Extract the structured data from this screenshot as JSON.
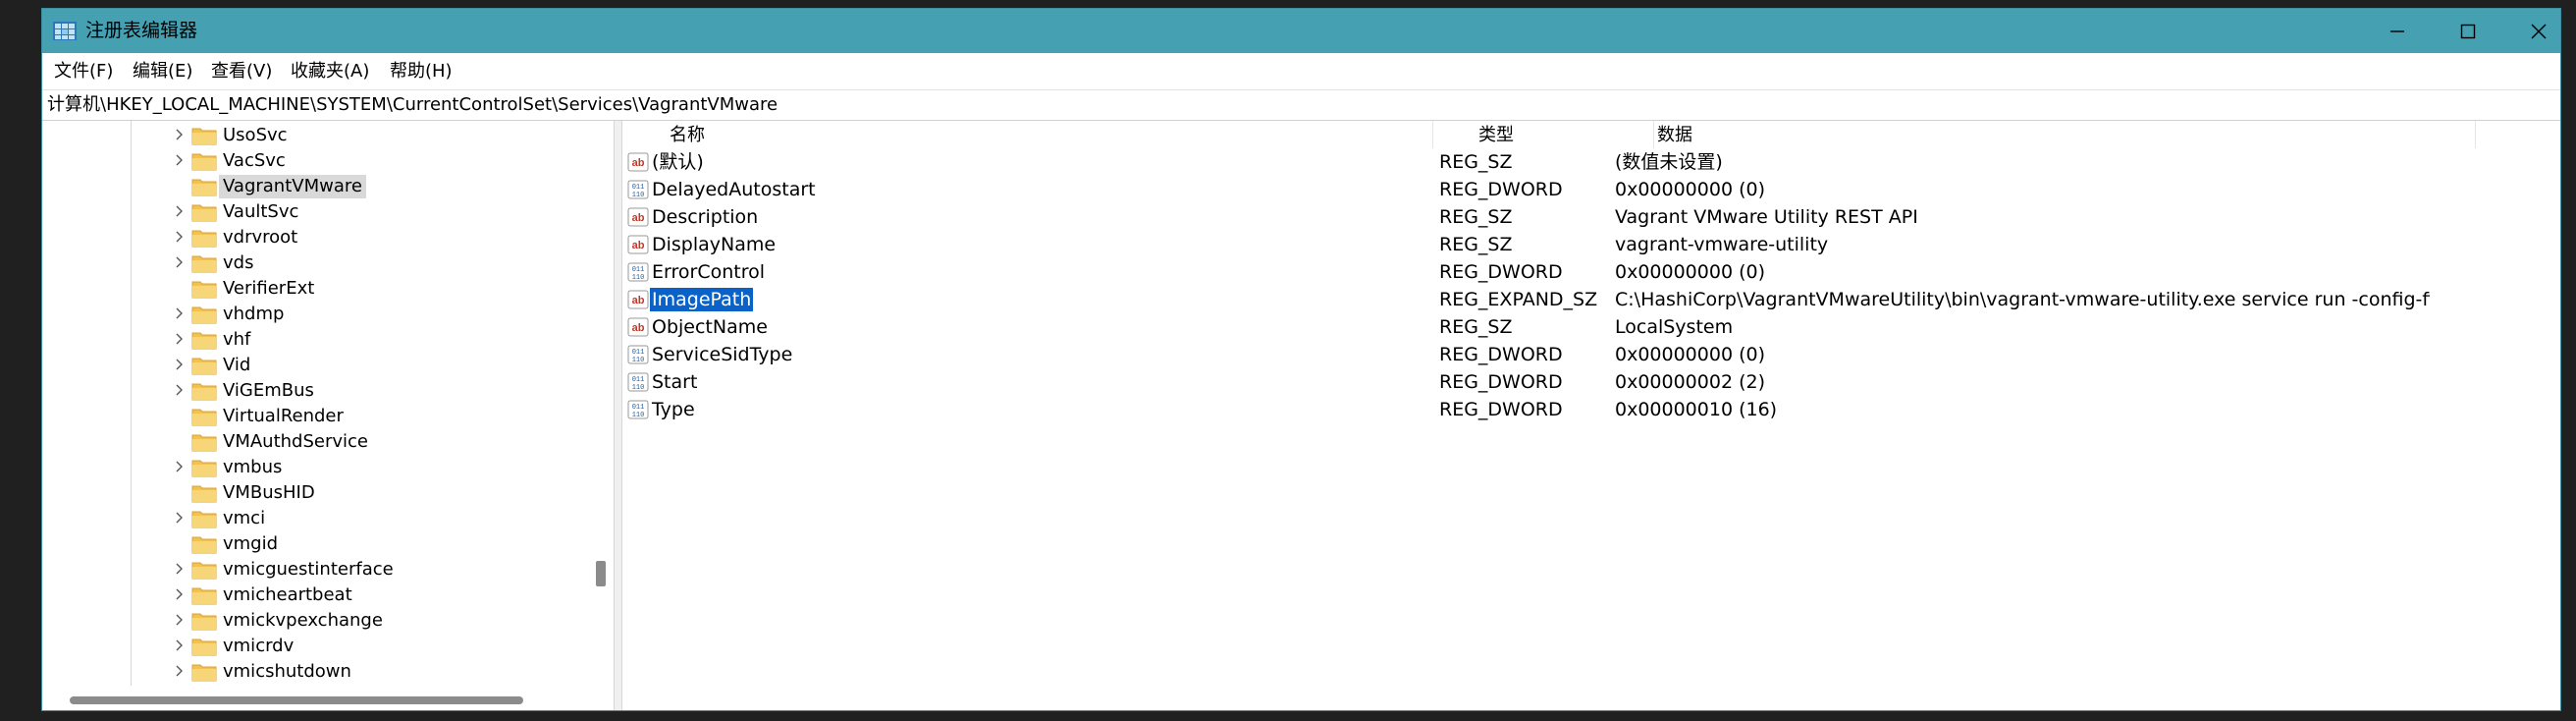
{
  "window": {
    "title": "注册表编辑器"
  },
  "menu": [
    "文件(F)",
    "编辑(E)",
    "查看(V)",
    "收藏夹(A)",
    "帮助(H)"
  ],
  "address": "计算机\\HKEY_LOCAL_MACHINE\\SYSTEM\\CurrentControlSet\\Services\\VagrantVMware",
  "tree": [
    {
      "label": "UsoSvc",
      "expandable": true
    },
    {
      "label": "VacSvc",
      "expandable": true
    },
    {
      "label": "VagrantVMware",
      "expandable": false,
      "selected": true
    },
    {
      "label": "VaultSvc",
      "expandable": true
    },
    {
      "label": "vdrvroot",
      "expandable": true
    },
    {
      "label": "vds",
      "expandable": true
    },
    {
      "label": "VerifierExt",
      "expandable": false
    },
    {
      "label": "vhdmp",
      "expandable": true
    },
    {
      "label": "vhf",
      "expandable": true
    },
    {
      "label": "Vid",
      "expandable": true
    },
    {
      "label": "ViGEmBus",
      "expandable": true
    },
    {
      "label": "VirtualRender",
      "expandable": false
    },
    {
      "label": "VMAuthdService",
      "expandable": false
    },
    {
      "label": "vmbus",
      "expandable": true
    },
    {
      "label": "VMBusHID",
      "expandable": false
    },
    {
      "label": "vmci",
      "expandable": true
    },
    {
      "label": "vmgid",
      "expandable": false
    },
    {
      "label": "vmicguestinterface",
      "expandable": true
    },
    {
      "label": "vmicheartbeat",
      "expandable": true
    },
    {
      "label": "vmickvpexchange",
      "expandable": true
    },
    {
      "label": "vmicrdv",
      "expandable": true
    },
    {
      "label": "vmicshutdown",
      "expandable": true
    }
  ],
  "columns": {
    "name": "名称",
    "type": "类型",
    "data": "数据"
  },
  "values": [
    {
      "icon": "string-value-icon",
      "name": "(默认)",
      "type": "REG_SZ",
      "data": "(数值未设置)"
    },
    {
      "icon": "binary-value-icon",
      "name": "DelayedAutostart",
      "type": "REG_DWORD",
      "data": "0x00000000 (0)"
    },
    {
      "icon": "string-value-icon",
      "name": "Description",
      "type": "REG_SZ",
      "data": "Vagrant VMware Utility REST API"
    },
    {
      "icon": "string-value-icon",
      "name": "DisplayName",
      "type": "REG_SZ",
      "data": "vagrant-vmware-utility"
    },
    {
      "icon": "binary-value-icon",
      "name": "ErrorControl",
      "type": "REG_DWORD",
      "data": "0x00000000 (0)"
    },
    {
      "icon": "string-value-icon",
      "name": "ImagePath",
      "type": "REG_EXPAND_SZ",
      "data": "C:\\HashiCorp\\VagrantVMwareUtility\\bin\\vagrant-vmware-utility.exe service run -config-file=\"C...",
      "selected": true
    },
    {
      "icon": "string-value-icon",
      "name": "ObjectName",
      "type": "REG_SZ",
      "data": "LocalSystem"
    },
    {
      "icon": "binary-value-icon",
      "name": "ServiceSidType",
      "type": "REG_DWORD",
      "data": "0x00000000 (0)"
    },
    {
      "icon": "binary-value-icon",
      "name": "Start",
      "type": "REG_DWORD",
      "data": "0x00000002 (2)"
    },
    {
      "icon": "binary-value-icon",
      "name": "Type",
      "type": "REG_DWORD",
      "data": "0x00000010 (16)"
    }
  ],
  "colors": {
    "titlebar": "#45a0b2",
    "selection": "#0a62c8",
    "folder": "#f2c14e"
  }
}
